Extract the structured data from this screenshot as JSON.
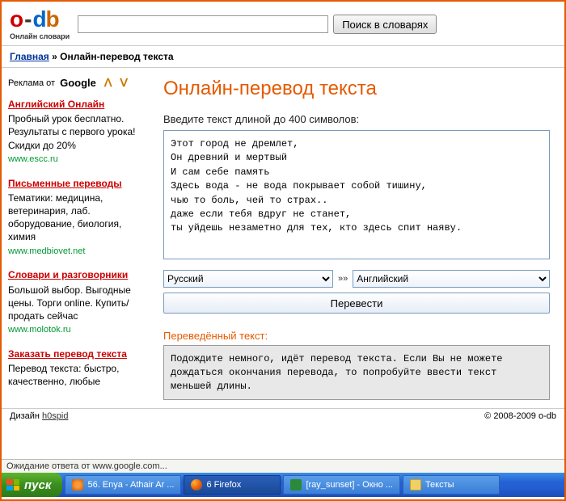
{
  "logo": {
    "sub": "Онлайн словари"
  },
  "search": {
    "value": "",
    "button": "Поиск в словарях"
  },
  "breadcrumb": {
    "home": "Главная",
    "sep": " » ",
    "current": "Онлайн-перевод текста"
  },
  "ads": {
    "header_pre": "Реклама от ",
    "header_brand": "Google",
    "items": [
      {
        "title": "Английский Онлайн",
        "body": "Пробный урок бесплатно. Результаты с первого урока! Скидки до 20%",
        "url": "www.escc.ru"
      },
      {
        "title": "Письменные переводы",
        "body": "Тематики: медицина, ветеринария, лаб. оборудование, биология, химия",
        "url": "www.medbiovet.net"
      },
      {
        "title": "Словари и разговорники",
        "body": "Большой выбор. Выгодные цены. Торги online. Купить/продать сейчас",
        "url": "www.molotok.ru"
      },
      {
        "title": "Заказать перевод текста",
        "body": "Перевод текста: быстро, качественно, любые",
        "url": ""
      }
    ]
  },
  "main": {
    "title": "Онлайн-перевод текста",
    "input_label": "Введите текст длиной до 400 символов:",
    "text": "Этот город не дремлет,\nОн древний и мертвый\nИ сам себе память\nЗдесь вода - не вода покрывает собой тишину,\nчью то боль, чей то страх..\nдаже если тебя вдруг не станет,\nты уйдешь незаметно для тех, кто здесь спит наяву.",
    "lang_from": "Русский",
    "lang_to": "Английский",
    "sep": "»»",
    "translate_btn": "Перевести",
    "result_label": "Переведённый текст:",
    "result_text": "Подождите немного, идёт перевод текста. Если Вы не можете дождаться окончания перевода, то попробуйте ввести текст меньшей длины."
  },
  "footer": {
    "design_pre": "Дизайн ",
    "design_link": "h0spid",
    "copyright": "© 2008-2009 o-db"
  },
  "status": "Ожидание ответа от www.google.com...",
  "taskbar": {
    "start": "пуск",
    "tasks": [
      {
        "icon": "wmp",
        "label": "56. Enya - Athair Ar ..."
      },
      {
        "icon": "ff",
        "label": "6 Firefox",
        "active": true
      },
      {
        "icon": "xl",
        "label": "[ray_sunset] - Окно ..."
      },
      {
        "icon": "fld",
        "label": "Тексты"
      }
    ]
  }
}
